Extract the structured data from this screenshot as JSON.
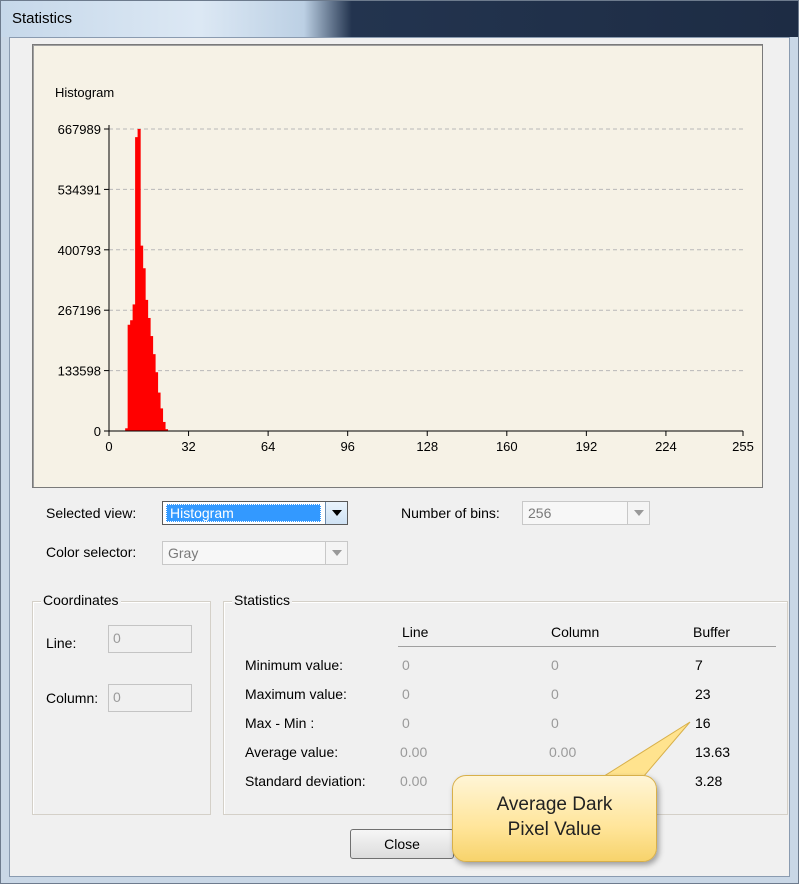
{
  "window": {
    "title": "Statistics"
  },
  "chart_data": {
    "type": "bar",
    "title": "Histogram",
    "ylim": [
      0,
      667989
    ],
    "yticks": [
      "667989",
      "534391",
      "400793",
      "267196",
      "133598",
      "0"
    ],
    "ytick_values": [
      667989,
      534391,
      400793,
      267196,
      133598,
      0
    ],
    "xticks": [
      "0",
      "32",
      "64",
      "96",
      "128",
      "160",
      "192",
      "224",
      "255"
    ],
    "xtick_values": [
      0,
      32,
      64,
      96,
      128,
      160,
      192,
      224,
      255
    ],
    "xlim": [
      0,
      255
    ],
    "grid": true,
    "color": "#ff0000",
    "x": [
      7,
      8,
      9,
      10,
      11,
      12,
      13,
      14,
      15,
      16,
      17,
      18,
      19,
      20,
      21,
      22,
      23
    ],
    "values": [
      6000,
      235000,
      245000,
      280000,
      650000,
      667989,
      410000,
      360000,
      290000,
      250000,
      210000,
      170000,
      130000,
      85000,
      50000,
      20000,
      4000
    ]
  },
  "controls": {
    "selected_view_label": "Selected view:",
    "selected_view_value": "Histogram",
    "color_selector_label": "Color selector:",
    "color_selector_value": "Gray",
    "bins_label": "Number of bins:",
    "bins_value": "256"
  },
  "coordinates": {
    "legend": "Coordinates",
    "line_label": "Line:",
    "line_value": "0",
    "column_label": "Column:",
    "column_value": "0"
  },
  "statistics": {
    "legend": "Statistics",
    "headers": [
      "Line",
      "Column",
      "Buffer"
    ],
    "rows": [
      {
        "label": "Minimum value:",
        "line": "0",
        "column": "0",
        "buffer": "7"
      },
      {
        "label": "Maximum value:",
        "line": "0",
        "column": "0",
        "buffer": "23"
      },
      {
        "label": "Max - Min :",
        "line": "0",
        "column": "0",
        "buffer": "16"
      },
      {
        "label": "Average value:",
        "line": "0.00",
        "column": "0.00",
        "buffer": "13.63"
      },
      {
        "label": "Standard deviation:",
        "line": "0.00",
        "column": "",
        "buffer": "3.28"
      }
    ]
  },
  "close_label": "Close",
  "callout": {
    "line1": "Average Dark",
    "line2": "Pixel Value"
  }
}
